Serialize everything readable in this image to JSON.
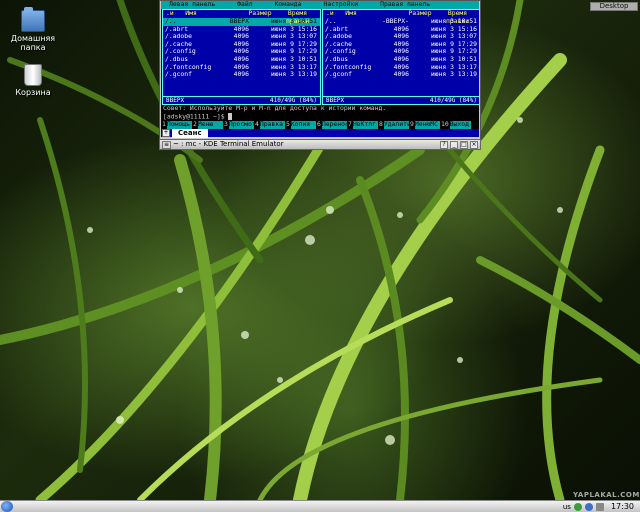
{
  "desktop": {
    "icons": [
      {
        "label_line1": "Домашняя",
        "label_line2": "папка",
        "icon": "home-folder-icon"
      },
      {
        "label_line1": "Корзина",
        "icon": "trash-icon"
      }
    ],
    "desktop_button": "Desktop",
    "watermark": "YAPLAKAL.COM"
  },
  "mc": {
    "menu": [
      "Левая панель",
      "Файл",
      "Команда",
      "Настройки",
      "Правая панель"
    ],
    "left_panel": {
      "header": {
        "name": "Имя",
        "size": "Размер",
        "time": "Время правки",
        "sort": ".и"
      },
      "rows": [
        {
          "name": "/..",
          "size": "ВВЕРХ",
          "time": "июня 3 10:51",
          "selected": true
        },
        {
          "name": "/.abrt",
          "size": "4096",
          "time": "июня 3 15:16"
        },
        {
          "name": "/.adobe",
          "size": "4096",
          "time": "июня 3 13:07"
        },
        {
          "name": "/.cache",
          "size": "4096",
          "time": "июня 9 17:29"
        },
        {
          "name": "/.config",
          "size": "4096",
          "time": "июня 9 17:29"
        },
        {
          "name": "/.dbus",
          "size": "4096",
          "time": "июня 3 10:51"
        },
        {
          "name": "/.fontconfig",
          "size": "4096",
          "time": "июня 3 13:17"
        },
        {
          "name": "/.gconf",
          "size": "4096",
          "time": "июня 3 13:19"
        }
      ],
      "footer_left": "ВВЕРХ",
      "footer_right": "410/49G (84%)"
    },
    "right_panel": {
      "header": {
        "name": "Имя",
        "size": "Размер",
        "time": "Время правки",
        "sort": ".и"
      },
      "rows": [
        {
          "name": "/..",
          "size": "-ВВЕРХ-",
          "time": "июня 3 10:51"
        },
        {
          "name": "/.abrt",
          "size": "4096",
          "time": "июня 3 15:16"
        },
        {
          "name": "/.adobe",
          "size": "4096",
          "time": "июня 3 13:07"
        },
        {
          "name": "/.cache",
          "size": "4096",
          "time": "июня 9 17:29"
        },
        {
          "name": "/.config",
          "size": "4096",
          "time": "июня 9 17:29"
        },
        {
          "name": "/.dbus",
          "size": "4096",
          "time": "июня 3 10:51"
        },
        {
          "name": "/.fontconfig",
          "size": "4096",
          "time": "июня 3 13:17"
        },
        {
          "name": "/.gconf",
          "size": "4096",
          "time": "июня 3 13:19"
        }
      ],
      "footer_left": "ВВЕРХ",
      "footer_right": "410/49G (84%)"
    },
    "hint": "Совет: Используйте M-p и M-n для доступа к истории команд.",
    "prompt": "[adsky@11111 ~]$ ",
    "fkeys": [
      {
        "n": "1",
        "l": "Помощь"
      },
      {
        "n": "2",
        "l": "Меню"
      },
      {
        "n": "3",
        "l": "Просмотр"
      },
      {
        "n": "4",
        "l": "Правка"
      },
      {
        "n": "5",
        "l": "Копия"
      },
      {
        "n": "6",
        "l": "Перенос"
      },
      {
        "n": "7",
        "l": "НвКтлг"
      },
      {
        "n": "8",
        "l": "Удалить"
      },
      {
        "n": "9",
        "l": "МенюМС"
      },
      {
        "n": "10",
        "l": "Выход"
      }
    ]
  },
  "terminal": {
    "session_tab": "Сеанс",
    "title": "~ : mc - KDE Terminal Emulator"
  },
  "taskbar": {
    "keyboard_layout": "us",
    "clock": "17:30"
  }
}
